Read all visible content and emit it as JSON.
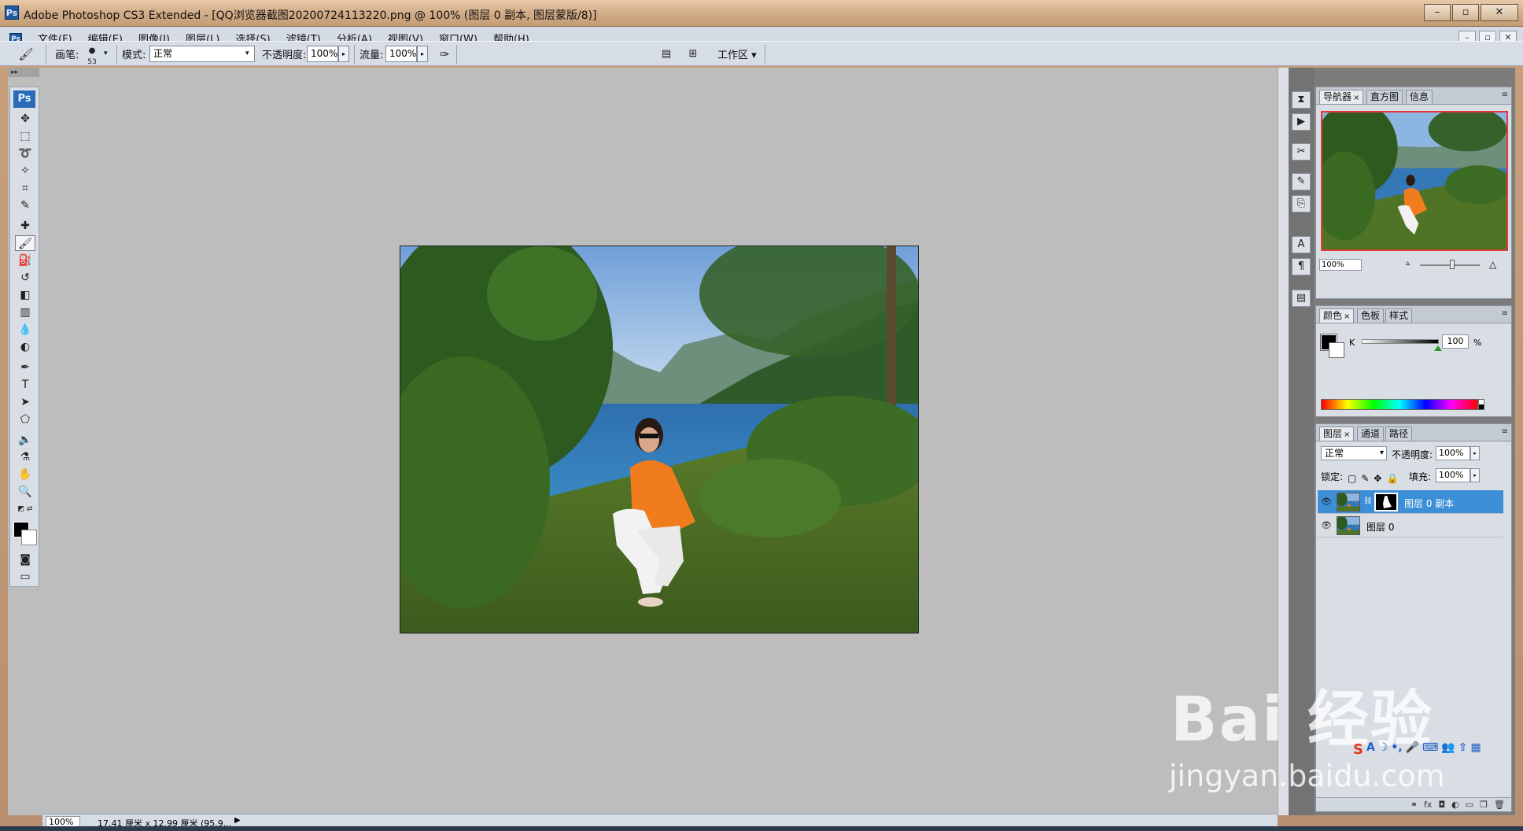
{
  "window": {
    "app_icon": "Ps",
    "title": "Adobe Photoshop CS3 Extended - [QQ浏览器截图20200724113220.png @ 100% (图层 0 副本, 图层蒙版/8)]",
    "btn_min": "–",
    "btn_max": "▫",
    "btn_close": "✕"
  },
  "menubar": {
    "items": [
      "文件(F)",
      "编辑(E)",
      "图像(I)",
      "图层(L)",
      "选择(S)",
      "滤镜(T)",
      "分析(A)",
      "视图(V)",
      "窗口(W)",
      "帮助(H)"
    ],
    "mdi_min": "–",
    "mdi_restore": "▫",
    "mdi_close": "✕"
  },
  "options": {
    "brush_label": "画笔:",
    "brush_size": "53",
    "mode_label": "模式:",
    "mode_value": "正常",
    "opacity_label": "不透明度:",
    "opacity_value": "100%",
    "flow_label": "流量:",
    "flow_value": "100%",
    "workspace_label": "工作区 ▾"
  },
  "toolbox": {
    "logo": "Ps"
  },
  "status": {
    "zoom": "100%",
    "doc_info": "17.41 厘米 x 12.99 厘米 (95.9..."
  },
  "navigator": {
    "tab_navigator": "导航器",
    "tab_histogram": "直方图",
    "tab_info": "信息",
    "zoom": "100%"
  },
  "color_panel": {
    "tab_color": "颜色",
    "tab_swatches": "色板",
    "tab_styles": "样式",
    "channel": "K",
    "value": "100",
    "unit": "%"
  },
  "layers_panel": {
    "tab_layers": "图层",
    "tab_channels": "通道",
    "tab_paths": "路径",
    "blend_mode": "正常",
    "opacity_label": "不透明度:",
    "opacity_value": "100%",
    "lock_label": "锁定:",
    "fill_label": "填充:",
    "fill_value": "100%",
    "layers": [
      {
        "name": "图层 0 副本",
        "selected": true,
        "has_mask": true
      },
      {
        "name": "图层 0",
        "selected": false,
        "has_mask": false
      }
    ]
  },
  "watermark": {
    "logo_text": "Bai 经验",
    "url": "jingyan.baidu.com"
  },
  "colors": {
    "selection": "#3c8ed6",
    "nav_frame": "#e13a3a",
    "workspace": "#bdbdbd"
  }
}
